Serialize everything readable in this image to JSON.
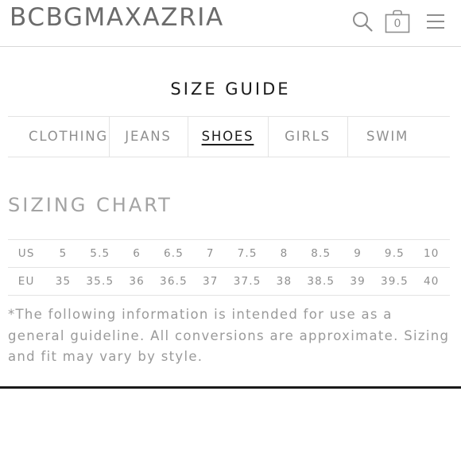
{
  "header": {
    "logo": "BCBGMAXAZRIA",
    "cart_count": "0"
  },
  "size_guide": {
    "title": "SIZE GUIDE",
    "tabs": [
      {
        "label": "CLOTHING",
        "active": false
      },
      {
        "label": "JEANS",
        "active": false
      },
      {
        "label": "SHOES",
        "active": true
      },
      {
        "label": "GIRLS",
        "active": false
      },
      {
        "label": "SWIM",
        "active": false
      }
    ]
  },
  "sizing_chart": {
    "title": "SIZING CHART",
    "rows": [
      {
        "label": "US",
        "values": [
          "5",
          "5.5",
          "6",
          "6.5",
          "7",
          "7.5",
          "8",
          "8.5",
          "9",
          "9.5",
          "10"
        ]
      },
      {
        "label": "EU",
        "values": [
          "35",
          "35.5",
          "36",
          "36.5",
          "37",
          "37.5",
          "38",
          "38.5",
          "39",
          "39.5",
          "40"
        ]
      }
    ],
    "disclaimer": "*The following information is intended for use as a general guideline. All conversions are approximate. Sizing and fit may vary by style."
  },
  "icons": {
    "search": "search-icon",
    "cart": "shopping-bag-icon",
    "menu": "hamburger-menu-icon"
  },
  "colors": {
    "text_dark": "#1a1a1a",
    "text_gray": "#8f8f8f",
    "divider": "#e3e3e3"
  }
}
